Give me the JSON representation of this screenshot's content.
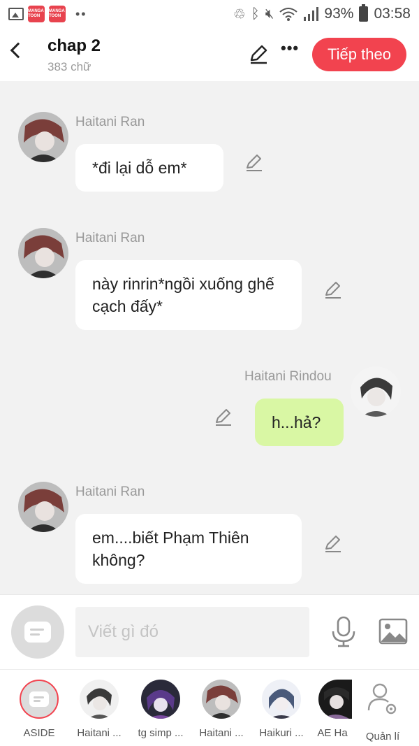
{
  "status_bar": {
    "app_badge_1": "MANGA TOON",
    "app_badge_2": "MANGA TOON",
    "dots": "••",
    "battery": "93%",
    "time": "03:58"
  },
  "header": {
    "title": "chap 2",
    "word_count": "383 chữ",
    "next_label": "Tiếp theo",
    "more_label": "•••"
  },
  "messages": [
    {
      "name": "Haitani Ran",
      "text": "*đi lại dỗ em*",
      "side": "left"
    },
    {
      "name": "Haitani Ran",
      "text": "này rinrin*ngồi xuống ghế cạch đấy*",
      "side": "left"
    },
    {
      "name": "Haitani Rindou",
      "text": "h...hả?",
      "side": "right"
    },
    {
      "name": "Haitani Ran",
      "text": "em....biết Phạm Thiên không?",
      "side": "left"
    }
  ],
  "input": {
    "placeholder": "Viết gì đó"
  },
  "characters": [
    {
      "label": "ASIDE",
      "selected": true
    },
    {
      "label": "Haitani ..."
    },
    {
      "label": "tg simp ..."
    },
    {
      "label": "Haitani ..."
    },
    {
      "label": "Haikuri ..."
    },
    {
      "label": "AE Ha"
    },
    {
      "label": "Quản lí"
    }
  ],
  "colors": {
    "accent": "#f2434f",
    "my_bubble": "#d9f7a4",
    "bubble": "#ffffff",
    "background": "#f2f2f2"
  }
}
